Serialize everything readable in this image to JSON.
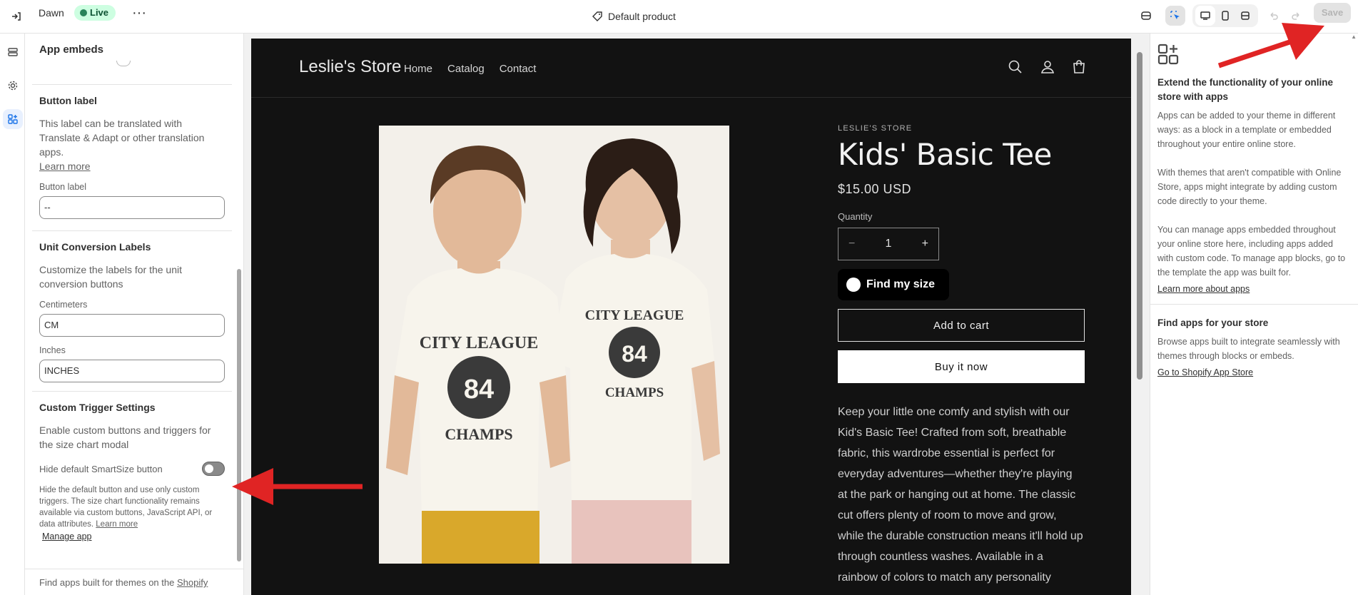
{
  "topbar": {
    "theme_name": "Dawn",
    "status_badge": "Live",
    "more_label": "···",
    "template_name": "Default product",
    "save_label": "Save"
  },
  "sidebar": {
    "title": "App embeds",
    "button_label_section": {
      "heading": "Button label",
      "description": "This label can be translated with Translate & Adapt or other translation apps.",
      "learn_more": "Learn more",
      "field_label": "Button label",
      "field_value": "--"
    },
    "unit_section": {
      "heading": "Unit Conversion Labels",
      "description": "Customize the labels for the unit conversion buttons",
      "cm_label": "Centimeters",
      "cm_value": "CM",
      "in_label": "Inches",
      "in_value": "INCHES"
    },
    "trigger_section": {
      "heading": "Custom Trigger Settings",
      "description": "Enable custom buttons and triggers for the size chart modal",
      "toggle_label": "Hide default SmartSize button",
      "help_text": "Hide the default button and use only custom triggers. The size chart functionality remains available via custom buttons, JavaScript API, or data attributes.",
      "help_link": "Learn more",
      "manage_app": "Manage app"
    },
    "footer_text": "Find apps built for themes on the",
    "footer_link": "Shopify"
  },
  "preview": {
    "store_name": "Leslie's Store",
    "nav": [
      "Home",
      "Catalog",
      "Contact"
    ],
    "vendor": "LESLIE'S STORE",
    "product_title": "Kids' Basic Tee",
    "price": "$15.00 USD",
    "quantity_label": "Quantity",
    "quantity_value": "1",
    "minus": "−",
    "plus": "+",
    "find_size": "Find my size",
    "add_to_cart": "Add to cart",
    "buy_now": "Buy it now",
    "description": "Keep your little one comfy and stylish with our Kid's Basic Tee! Crafted from soft, breathable fabric, this wardrobe essential is perfect for everyday adventures—whether they're playing at the park or hanging out at home. The classic cut offers plenty of room to move and grow, while the durable construction means it'll hold up through countless washes. Available in a rainbow of colors to match any personality",
    "shirt_text_top": "CITY LEAGUE",
    "shirt_number": "84",
    "shirt_text_bottom": "CHAMPS"
  },
  "rightpanel": {
    "heading1": "Extend the functionality of your online store with apps",
    "para1": "Apps can be added to your theme in different ways: as a block in a template or embedded throughout your entire online store.",
    "para2": "With themes that aren't compatible with Online Store, apps might integrate by adding custom code directly to your theme.",
    "para3": "You can manage apps embedded throughout your online store here, including apps added with custom code. To manage app blocks, go to the template the app was built for.",
    "link1": "Learn more about apps",
    "heading2": "Find apps for your store",
    "para4": "Browse apps built to integrate seamlessly with themes through blocks or embeds.",
    "link2": "Go to Shopify App Store"
  },
  "colors": {
    "accent_red": "#e02424",
    "live_green": "#29845a",
    "preview_bg": "#121212"
  }
}
